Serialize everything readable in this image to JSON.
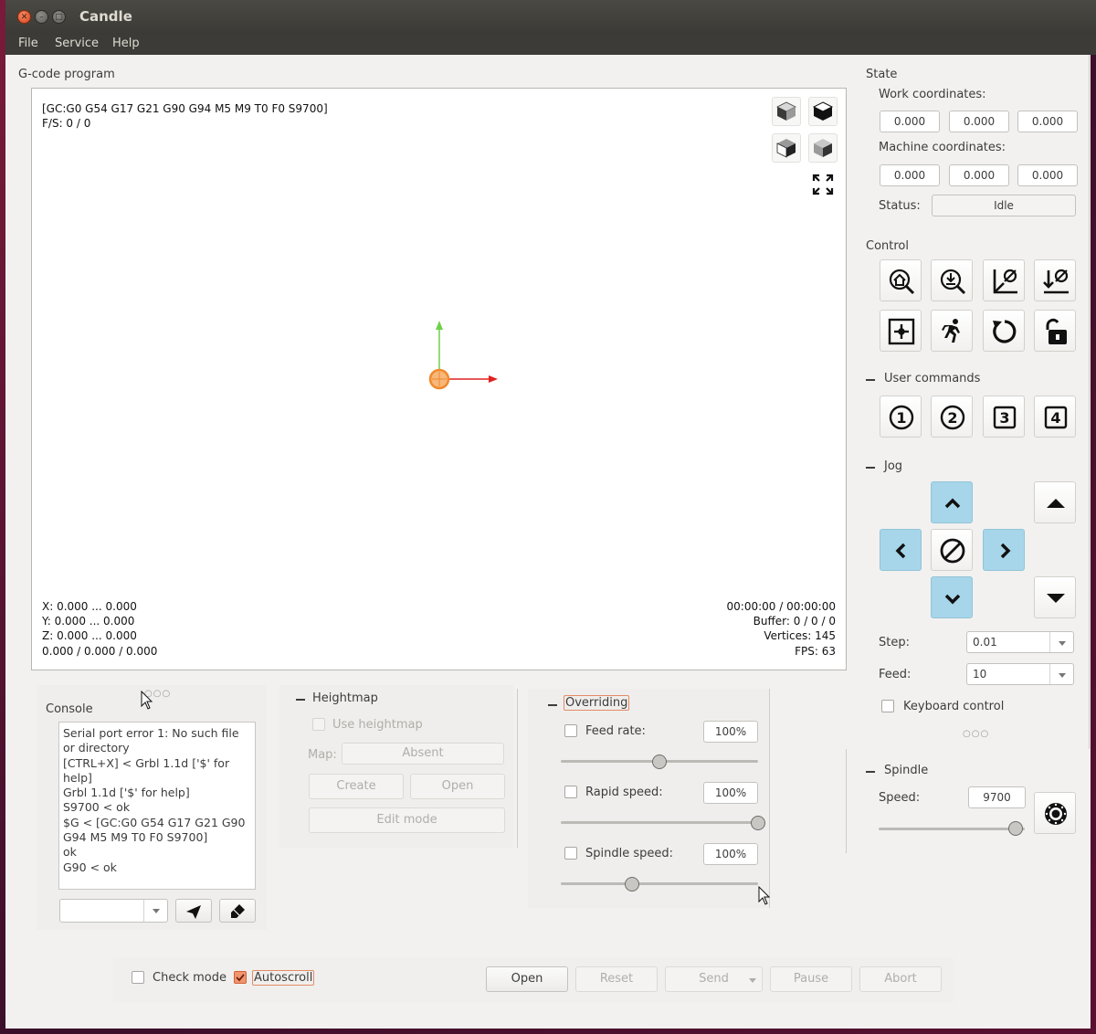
{
  "window": {
    "title": "Candle"
  },
  "menu": [
    "File",
    "Service",
    "Help"
  ],
  "viewer": {
    "section_label": "G-code program",
    "gc_state": "[GC:G0 G54 G17 G21 G90 G94 M5 M9 T0 F0 S9700]",
    "fs": "F/S: 0 / 0",
    "x_range": "X: 0.000 ... 0.000",
    "y_range": "Y: 0.000 ... 0.000",
    "z_range": "Z: 0.000 ... 0.000",
    "size": "0.000 / 0.000 / 0.000",
    "time": "00:00:00 / 00:00:00",
    "buffer": "Buffer: 0 / 0 / 0",
    "vertices": "Vertices: 145",
    "fps": "FPS: 63",
    "view_icons": [
      "cube-front-icon",
      "cube-top-icon",
      "cube-left-icon",
      "cube-iso-icon",
      "fit-view-icon"
    ],
    "axis_colors": {
      "x": "#e02020",
      "y": "#6fd04a",
      "tool": "#f08a2c"
    }
  },
  "state": {
    "title": "State",
    "work_label": "Work coordinates:",
    "work": [
      "0.000",
      "0.000",
      "0.000"
    ],
    "machine_label": "Machine coordinates:",
    "machine": [
      "0.000",
      "0.000",
      "0.000"
    ],
    "status_label": "Status:",
    "status": "Idle"
  },
  "control": {
    "title": "Control",
    "icons": [
      "home-icon",
      "probe-z-icon",
      "zero-xy-icon",
      "zero-z-icon",
      "restore-origin-icon",
      "safe-position-icon",
      "reset-icon",
      "unlock-icon"
    ]
  },
  "user_commands": {
    "title": "User commands",
    "buttons": [
      "1",
      "2",
      "3",
      "4"
    ]
  },
  "jog": {
    "title": "Jog",
    "step_label": "Step:",
    "step": "0.01",
    "feed_label": "Feed:",
    "feed": "10",
    "keyboard_label": "Keyboard control"
  },
  "spindle": {
    "title": "Spindle",
    "speed_label": "Speed:",
    "speed": "9700",
    "slider": 0.94
  },
  "console": {
    "title": "Console",
    "lines": [
      "Serial port error 1: No such file or directory",
      "[CTRL+X] < Grbl 1.1d ['$' for help]",
      "Grbl 1.1d ['$' for help]",
      "S9700 < ok",
      "$G < [GC:G0 G54 G17 G21 G90 G94 M5 M9 T0 F0 S9700]",
      "ok",
      "G90 < ok"
    ],
    "command": ""
  },
  "heightmap": {
    "title": "Heightmap",
    "use_label": "Use heightmap",
    "map_label": "Map:",
    "map_value": "Absent",
    "create": "Create",
    "open": "Open",
    "edit": "Edit mode"
  },
  "overriding": {
    "title": "Overriding",
    "feed_label": "Feed rate:",
    "feed_value": "100%",
    "feed_slider": 0.5,
    "rapid_label": "Rapid speed:",
    "rapid_value": "100%",
    "rapid_slider": 1.0,
    "spindle_label": "Spindle speed:",
    "spindle_value": "100%",
    "spindle_slider": 0.36
  },
  "bottom": {
    "check_mode": "Check mode",
    "autoscroll": "Autoscroll",
    "open": "Open",
    "reset": "Reset",
    "send": "Send",
    "pause": "Pause",
    "abort": "Abort"
  }
}
